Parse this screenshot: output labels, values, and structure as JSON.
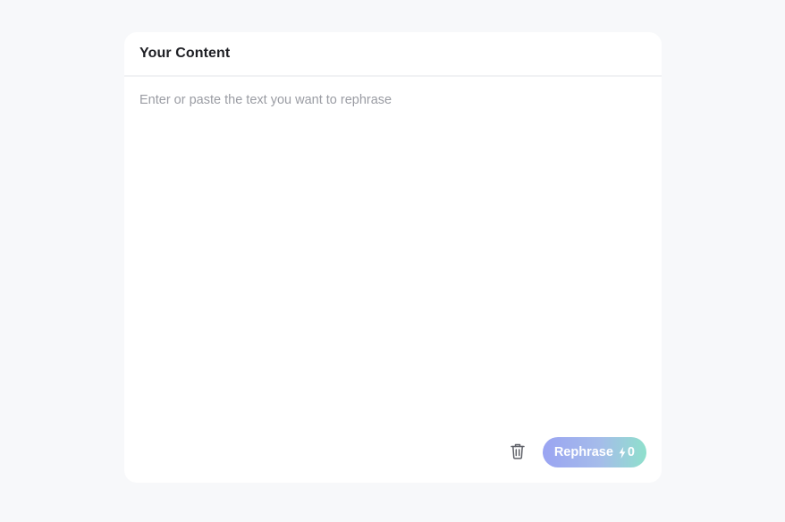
{
  "card": {
    "title": "Your Content"
  },
  "editor": {
    "value": "",
    "placeholder": "Enter or paste the text you want to rephrase"
  },
  "footer": {
    "trash_icon": "trash-icon",
    "rephrase_label": "Rephrase",
    "bolt_icon": "lightning-bolt-icon",
    "credit_count": "0"
  },
  "colors": {
    "page_background": "#f7f8fa",
    "card_background": "#ffffff",
    "title_text": "#1e1f24",
    "placeholder_text": "#9a9ca3",
    "button_gradient_start": "#9aa4f2",
    "button_gradient_end": "#8fe0cc"
  }
}
